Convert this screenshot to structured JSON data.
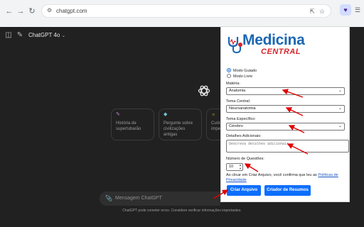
{
  "browser": {
    "url": "chatgpt.com",
    "back_icon": "arrow-left-icon",
    "forward_icon": "arrow-right-icon",
    "reload_icon": "reload-icon"
  },
  "chat": {
    "model": "ChatGPT 4o",
    "suggestions": [
      {
        "text": "História de supertubarão",
        "icon": "pencil-icon",
        "color": "#c285d6"
      },
      {
        "text": "Pergunte sobre civilizações antigas",
        "icon": "graduation-cap-icon",
        "color": "#6ec6d9"
      },
      {
        "text": "Curio impe",
        "icon": "lightbulb-icon",
        "color": "#e2c541"
      }
    ],
    "composer_placeholder": "Mensagem ChatGPT",
    "disclaimer": "ChatGPT pode cometer erros. Considere verificar informações importantes."
  },
  "popup": {
    "brand_title": "Medicina",
    "brand_subtitle": "CENTRAL",
    "brand_colors": {
      "blue": "#1b67b4",
      "red": "#d9242a"
    },
    "modes": [
      {
        "label": "Modo Guiado",
        "selected": true
      },
      {
        "label": "Modo Livre",
        "selected": false
      }
    ],
    "materia_label": "Matéria:",
    "materia_value": "Anatomia",
    "tema_central_label": "Tema Central:",
    "tema_central_value": "Neuroanatomia",
    "tema_especifico_label": "Tema Específico:",
    "tema_especifico_value": "Cérebro",
    "detalhes_label": "Detalhes Adicionais:",
    "detalhes_placeholder": "Descreva detalhes adicionais...",
    "num_questoes_label": "Número de Questões:",
    "num_questoes_value": "10",
    "consent_text": "Ao clicar em Criar Arquivo, você confirma que leu as ",
    "consent_link": "Políticas de Privacidade",
    "btn_criar": "Criar Arquivo",
    "btn_resumos": "Criador de Resumos",
    "button_color": "#0d6efd"
  }
}
